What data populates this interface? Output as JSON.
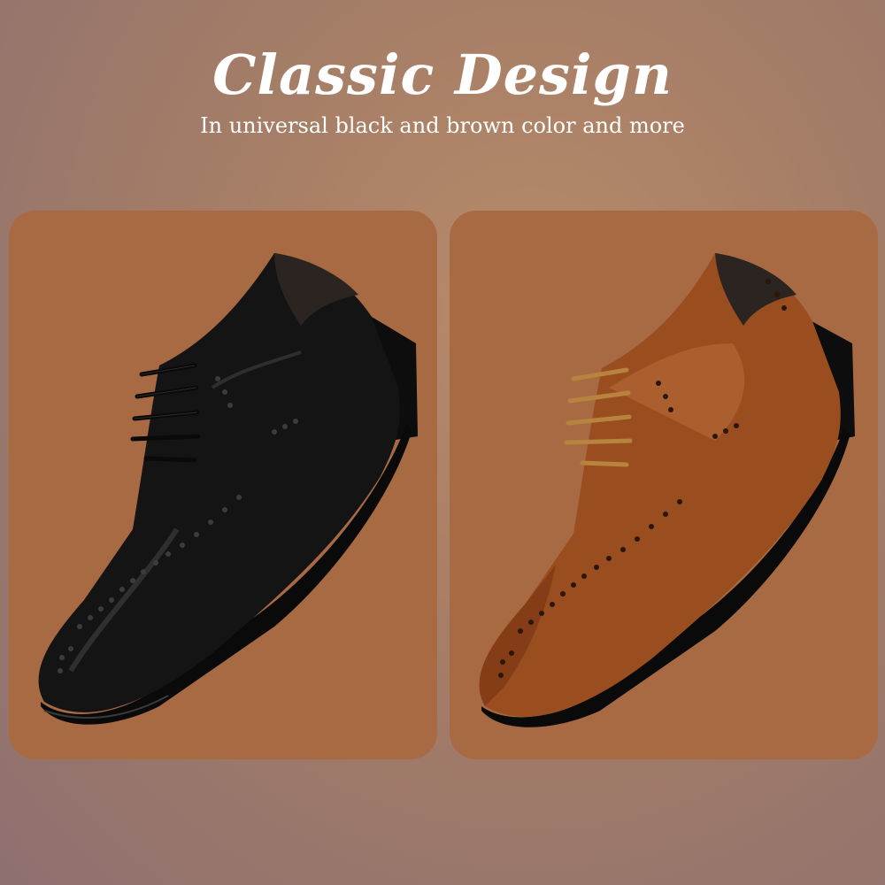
{
  "header": {
    "title": "Classic Design",
    "subtitle": "In universal black and brown color and more"
  },
  "products": [
    {
      "name": "black-shoe",
      "color": "#141414"
    },
    {
      "name": "brown-shoe",
      "color": "#9a4d1f"
    }
  ],
  "colors": {
    "card_bg": "#a86a43",
    "background": "#a47d67",
    "text": "#ffffff"
  }
}
